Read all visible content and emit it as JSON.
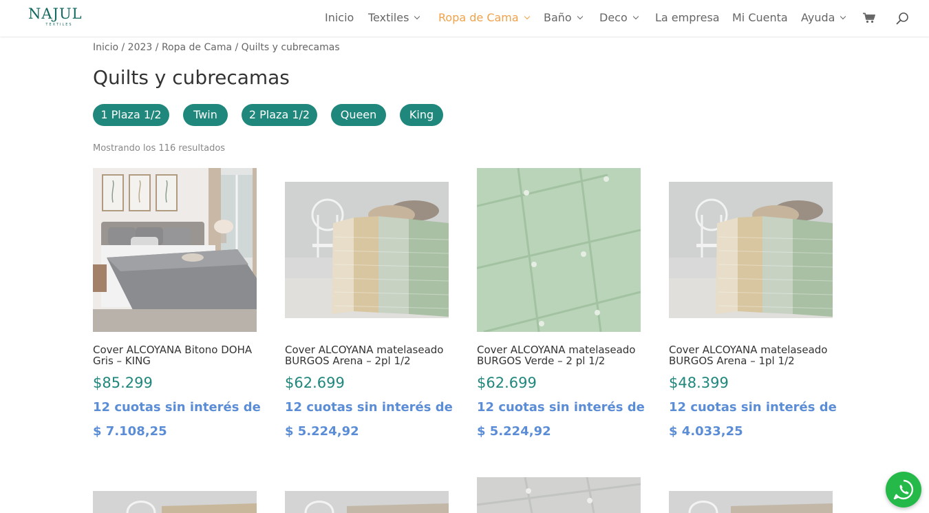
{
  "brand": {
    "name": "NAJUL",
    "tagline": "TEXTILES",
    "color": "#13685f"
  },
  "nav": {
    "items": [
      {
        "label": "Inicio",
        "dropdown": false,
        "active": false
      },
      {
        "label": "Textiles",
        "dropdown": true,
        "active": false
      },
      {
        "label": "Ropa de Cama",
        "dropdown": true,
        "active": true
      },
      {
        "label": "Baño",
        "dropdown": true,
        "active": false
      },
      {
        "label": "Deco",
        "dropdown": true,
        "active": false
      },
      {
        "label": "La empresa",
        "dropdown": false,
        "active": false
      },
      {
        "label": "Mi Cuenta",
        "dropdown": false,
        "active": false
      },
      {
        "label": "Ayuda",
        "dropdown": true,
        "active": false
      }
    ],
    "active_color": "#f0a24a",
    "icons": [
      "cart-icon",
      "search-icon"
    ]
  },
  "breadcrumb": {
    "items": [
      "Inicio",
      "2023",
      "Ropa de Cama",
      "Quilts y cubrecamas"
    ],
    "separator": " / "
  },
  "page": {
    "title": "Quilts y cubrecamas",
    "filters": [
      "1 Plaza 1/2",
      "Twin",
      "2 Plaza 1/2",
      "Queen",
      "King"
    ],
    "filter_color": "#1f877c",
    "result_count": "Mostrando los 116 resultados"
  },
  "products": [
    {
      "title": "Cover ALCOYANA Bitono DOHA Gris – KING",
      "price": "$85.299",
      "installments_label": "12 cuotas sin interés de",
      "installment_amount": "$ 7.108,25",
      "image": "grey-bedroom-photo"
    },
    {
      "title": "Cover ALCOYANA matelaseado BURGOS Arena – 2pl 1/2",
      "price": "$62.699",
      "installments_label": "12 cuotas sin interés de",
      "installment_amount": "$ 5.224,92",
      "image": "striped-quilt-photo"
    },
    {
      "title": "Cover ALCOYANA matelaseado BURGOS Verde – 2 pl 1/2",
      "price": "$62.699",
      "installments_label": "12 cuotas sin interés de",
      "installment_amount": "$ 5.224,92",
      "image": "green-quilted-texture-photo"
    },
    {
      "title": "Cover ALCOYANA matelaseado BURGOS Arena – 1pl 1/2",
      "price": "$48.399",
      "installments_label": "12 cuotas sin interés de",
      "installment_amount": "$ 4.033,25",
      "image": "striped-quilt-photo"
    }
  ],
  "colors": {
    "price": "#1f877c",
    "installment": "#5b8dd6",
    "whatsapp": "#25b94a"
  },
  "whatsapp_icon": "whatsapp-icon"
}
